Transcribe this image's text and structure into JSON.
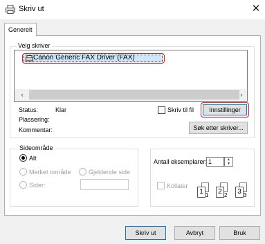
{
  "window": {
    "title": "Skriv ut",
    "close_glyph": "✕"
  },
  "tabs": [
    {
      "label": "Generelt"
    }
  ],
  "printer_group": {
    "legend": "Velg skriver",
    "printers": [
      {
        "name": "Canon Generic FAX Driver (FAX)",
        "icon": "fax-printer-icon",
        "selected": true
      }
    ],
    "scroll_left": "‹",
    "scroll_right": "›"
  },
  "status": {
    "status_label": "Status:",
    "status_value": "Klar",
    "location_label": "Plassering:",
    "comment_label": "Kommentar:",
    "print_to_file_label": "Skriv til fil",
    "preferences_button": "Innstillinger",
    "find_printer_button": "Søk etter skriver..."
  },
  "page_range": {
    "legend": "Sideområde",
    "all_label": "Alt",
    "selection_label": "Merket område",
    "current_page_label": "Gjeldende side",
    "pages_label": "Sider:",
    "pages_value": ""
  },
  "copies": {
    "label": "Antall eksemplarer:",
    "value": "1",
    "collate_label": "Kollater",
    "collate_icon_numbers": [
      "1",
      "1",
      "2",
      "2",
      "3",
      "3"
    ]
  },
  "buttons": {
    "print": "Skriv ut",
    "cancel": "Avbryt",
    "apply": "Bruk"
  },
  "colors": {
    "highlight": "#e11b1b",
    "selection": "#cce8ff",
    "accent": "#0078d7"
  }
}
